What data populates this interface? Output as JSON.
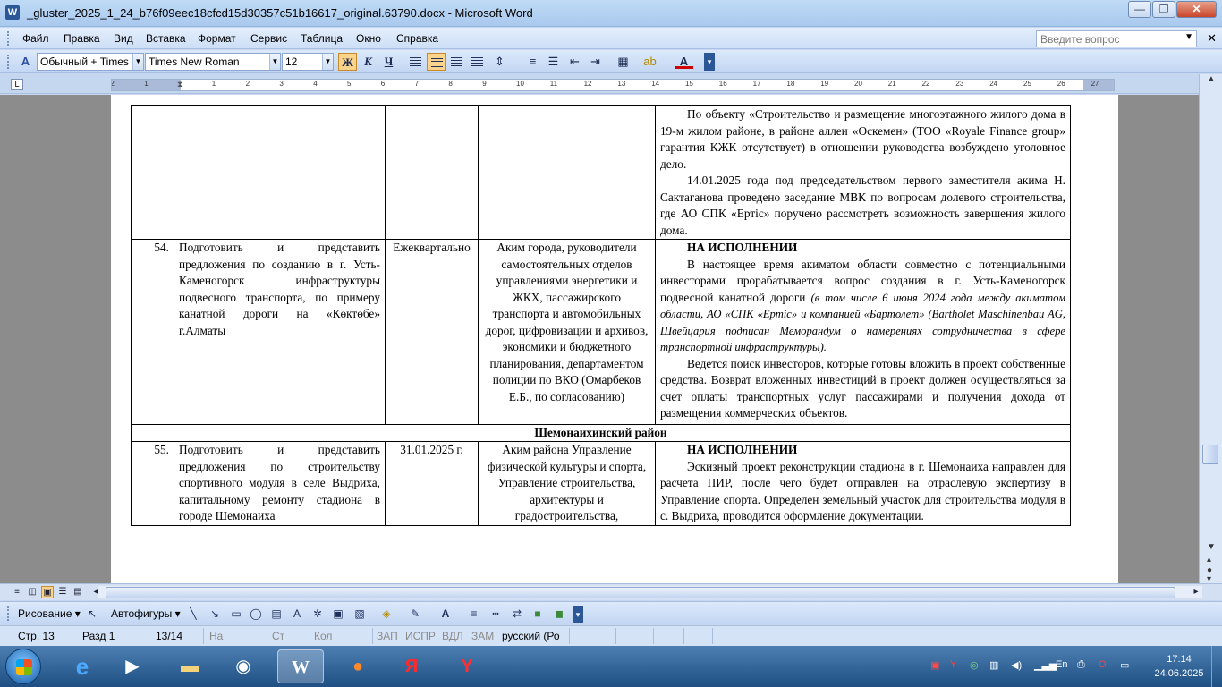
{
  "window": {
    "title": "_gluster_2025_1_24_b76f09eec18cfcd15d30357c51b16617_original.63790.docx - Microsoft Word",
    "minimize": "—",
    "restore": "❐",
    "close": "✕"
  },
  "menu": {
    "items": [
      "Файл",
      "Правка",
      "Вид",
      "Вставка",
      "Формат",
      "Сервис",
      "Таблица",
      "Окно",
      "Справка"
    ],
    "help_placeholder": "Введите вопрос"
  },
  "format_toolbar": {
    "style": "Обычный + Times",
    "font": "Times New Roman",
    "size": "12",
    "bold": "Ж",
    "italic": "К",
    "underline": "Ч",
    "align_active": "center"
  },
  "ruler": {
    "ticks": [
      "2",
      "1",
      "1",
      "2",
      "3",
      "4",
      "5",
      "6",
      "7",
      "8",
      "9",
      "10",
      "11",
      "12",
      "13",
      "14",
      "15",
      "16",
      "17",
      "18",
      "19",
      "20",
      "21",
      "22",
      "23",
      "24",
      "25",
      "26",
      "27"
    ]
  },
  "document": {
    "row_cont": {
      "col5": [
        "По объекту «Строительство и размещение многоэтажного жилого дома в 19-м жилом районе, в районе аллеи «Өскемен» (ТОО «Royale Finance group» гарантия КЖК отсутствует) в отношении руководства возбуждено уголовное дело.",
        "14.01.2025 года под председательством первого заместителя акима Н. Сактаганова проведено заседание МВК по вопросам долевого строительства, где АО СПК «Ертіс» поручено рассмотреть возможность завершения жилого дома."
      ]
    },
    "row54": {
      "num": "54.",
      "task": "Подготовить и представить предложения по созданию в г. Усть-Каменогорск инфраструктуры подвесного транспорта, по примеру канатной дороги на «Көктөбе» г.Алматы",
      "deadline": "Ежеквартально",
      "responsible": "Аким города, руководители самостоятельных отделов управлениями энергетики и ЖКХ, пассажирского транспорта и автомобильных дорог, цифровизации и архивов, экономики и бюджетного планирования, департаментом полиции по ВКО (Омарбеков Е.Б., по согласованию)",
      "status": "НА ИСПОЛНЕНИИ",
      "p1": "В настоящее время акиматом области совместно с потенциальными инвесторами прорабатывается вопрос создания в г. Усть-Каменогорск подвесной канатной дороги",
      "p1_italic": "(в том числе 6 июня 2024 года между акиматом области, АО «СПК «Ертіс» и компанией «Бартолет» (Bartholet Maschinenbau AG, Швейцария подписан Меморандум о намерениях сотрудничества в сфере транспортной инфраструктуры).",
      "p2": "Ведется поиск инвесторов, которые готовы вложить в проект собственные средства. Возврат вложенных инвестиций в проект должен осуществляться за счет оплаты транспортных услуг пассажирами и получения дохода от размещения коммерческих объектов."
    },
    "section": "Шемонаихинский район",
    "row55": {
      "num": "55.",
      "task": "Подготовить и представить предложения по строительству спортивного модуля в селе Выдриха, капитальному ремонту стадиона в городе Шемонаиха",
      "deadline": "31.01.2025 г.",
      "responsible": "Аким района Управление физической культуры и спорта, Управление строительства, архитектуры и градостроительства,",
      "status": "НА ИСПОЛНЕНИИ",
      "p1": "Эскизный проект реконструкции стадиона в г. Шемонаиха направлен для расчета ПИР, после чего будет отправлен на отраслевую экспертизу в Управление спорта. Определен земельный участок для строительства модуля в с. Выдриха, проводится оформление документации."
    }
  },
  "drawing_toolbar": {
    "drawing": "Рисование ▾",
    "autoshapes": "Автофигуры ▾"
  },
  "status_bar": {
    "page": "Стр.  13",
    "section": "Разд  1",
    "pages": "13/14",
    "at": "На",
    "line": "Ст",
    "col": "Кол",
    "rec": "ЗАП",
    "trk": "ИСПР",
    "ext": "ВДЛ",
    "ovr": "ЗАМ",
    "lang": "русский (Ро"
  },
  "taskbar": {
    "lang": "En",
    "time": "17:14",
    "date": "24.06.2025"
  }
}
